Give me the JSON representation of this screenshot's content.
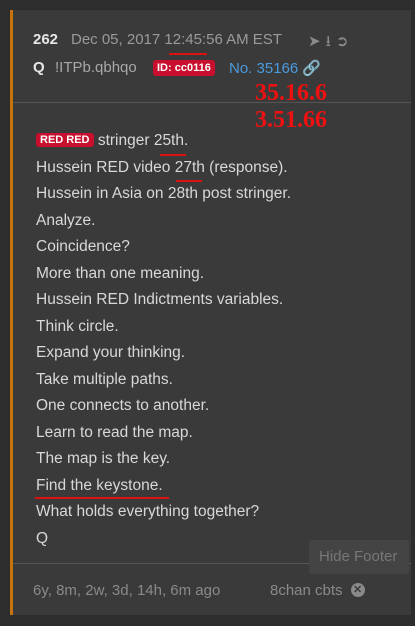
{
  "post": {
    "number": "262",
    "date": "Dec 05, 2017 12:45:56 AM EST",
    "author": "Q",
    "tripcode": "!ITPb.qbhqo",
    "id_badge": "ID: cc0116",
    "post_link": "No. 35166",
    "header_icons": [
      "share-icon",
      "download-icon",
      "arrow-right-circle-icon"
    ]
  },
  "annotations": {
    "line1": "35.16.6",
    "line2": "3.51.66",
    "color": "#ee1111"
  },
  "body": {
    "red_badge": "RED RED",
    "lines": [
      "stringer 25th.",
      "Hussein RED video 27th (response).",
      "Hussein in Asia on 28th post stringer.",
      "Analyze.",
      "Coincidence?",
      "More than one meaning.",
      "Hussein RED Indictments variables.",
      "Think circle.",
      "Expand your thinking.",
      "Take multiple paths.",
      "One connects to another.",
      "Learn to read the map.",
      "The map is the key.",
      "Find the keystone.",
      "What holds everything together?",
      "Q"
    ]
  },
  "footer": {
    "age": "6y, 8m, 2w, 3d, 14h, 6m ago",
    "source": "8chan cbts",
    "hide_label": "Hide Footer"
  },
  "colors": {
    "accent": "#c8720e",
    "badge": "#c8102e",
    "link": "#4a9be0"
  }
}
